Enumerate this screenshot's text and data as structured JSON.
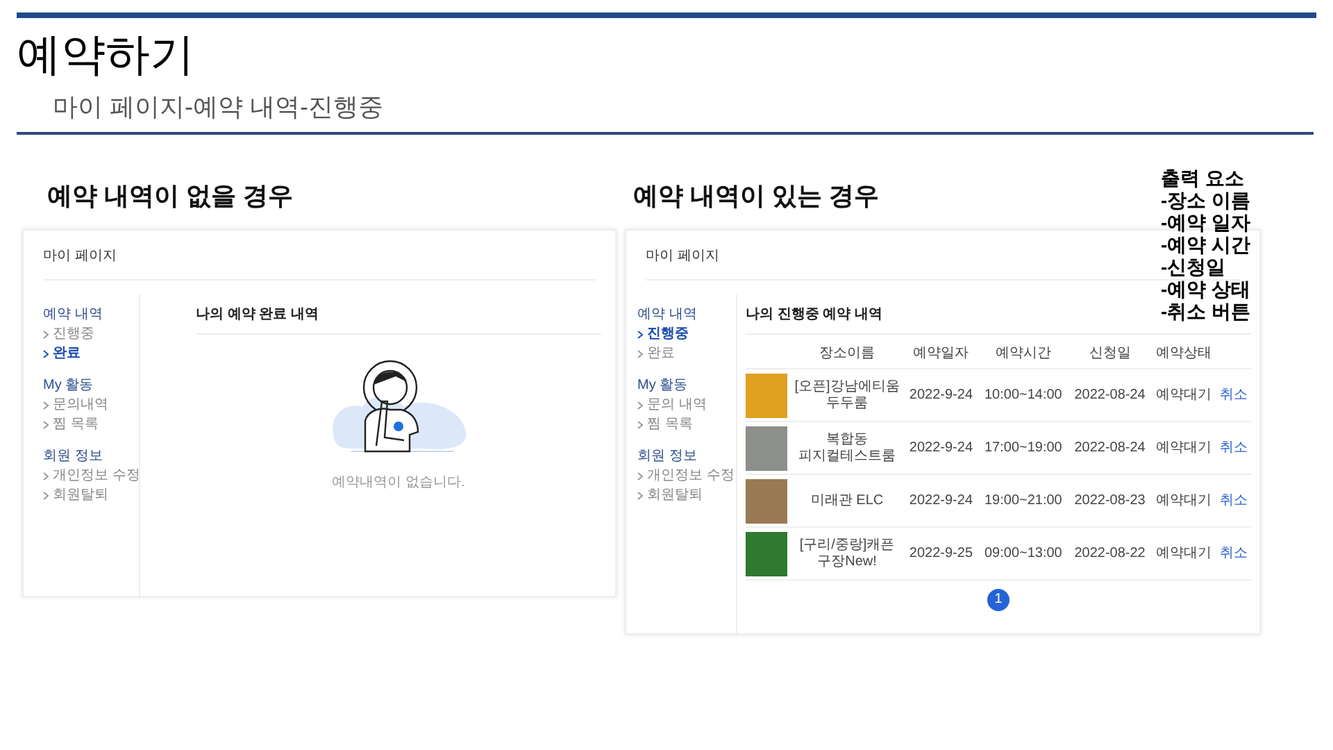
{
  "slide": {
    "title": "예약하기",
    "subtitle": "마이 페이지-예약 내역-진행중"
  },
  "cases": [
    {
      "kind": "empty",
      "heading": "예약 내역이 없을 경우",
      "page_title": "마이 페이지",
      "sidebar": [
        {
          "title": "예약 내역",
          "items": [
            {
              "label": "진행중",
              "selected": false
            },
            {
              "label": "완료",
              "selected": true
            }
          ]
        },
        {
          "title": "My 활동",
          "items": [
            {
              "label": "문의내역",
              "selected": false
            },
            {
              "label": "찜 목록",
              "selected": false
            }
          ]
        },
        {
          "title": "회원 정보",
          "items": [
            {
              "label": "개인정보 수정",
              "selected": false
            },
            {
              "label": "회원탈퇴",
              "selected": false
            }
          ]
        }
      ],
      "content_title": "나의 예약 완료 내역",
      "empty_message": "예약내역이 없습니다."
    },
    {
      "kind": "list",
      "heading": "예약 내역이 있는 경우",
      "page_title": "마이 페이지",
      "sidebar": [
        {
          "title": "예약 내역",
          "items": [
            {
              "label": "진행중",
              "selected": true
            },
            {
              "label": "완료",
              "selected": false
            }
          ]
        },
        {
          "title": "My 활동",
          "items": [
            {
              "label": "문의 내역",
              "selected": false
            },
            {
              "label": "찜 목록",
              "selected": false
            }
          ]
        },
        {
          "title": "회원 정보",
          "items": [
            {
              "label": "개인정보 수정",
              "selected": false
            },
            {
              "label": "회원탈퇴",
              "selected": false
            }
          ]
        }
      ],
      "content_title": "나의 진행중 예약 내역",
      "table": {
        "columns": [
          "장소이름",
          "예약일자",
          "예약시간",
          "신청일",
          "예약상태"
        ],
        "rows": [
          {
            "place": "[오픈]강남에티움 두두룸",
            "date": "2022-9-24",
            "time": "10:00~14:00",
            "applied": "2022-08-24",
            "status": "예약대기",
            "action": "취소"
          },
          {
            "place": "복합동 피지컬테스트룸",
            "date": "2022-9-24",
            "time": "17:00~19:00",
            "applied": "2022-08-24",
            "status": "예약대기",
            "action": "취소"
          },
          {
            "place": "미래관 ELC",
            "date": "2022-9-24",
            "time": "19:00~21:00",
            "applied": "2022-08-23",
            "status": "예약대기",
            "action": "취소"
          },
          {
            "place": "[구리/중랑]캐픈 구장New!",
            "date": "2022-9-25",
            "time": "09:00~13:00",
            "applied": "2022-08-22",
            "status": "예약대기",
            "action": "취소"
          }
        ]
      },
      "pagination": [
        {
          "label": "1",
          "selected": true
        }
      ]
    }
  ],
  "notes": {
    "title": "출력 요소",
    "items": [
      "-장소 이름",
      "-예약 일자",
      "-예약 시간",
      "-신청일",
      "-예약 상태",
      "-취소 버튼"
    ]
  }
}
